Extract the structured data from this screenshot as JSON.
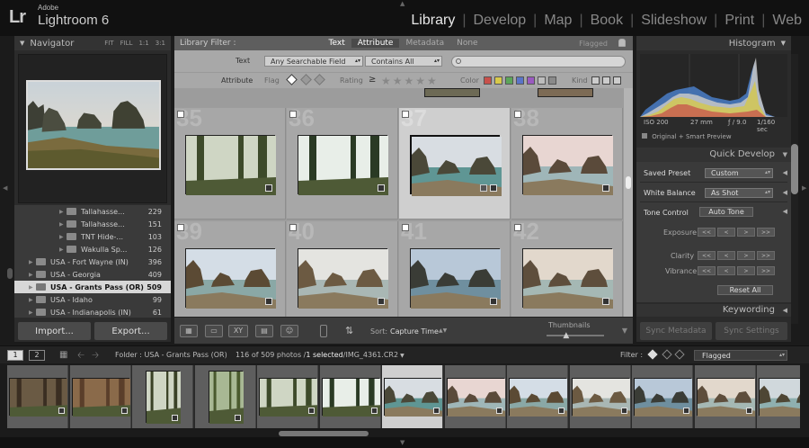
{
  "app": {
    "logo": "Lr",
    "vendor": "Adobe",
    "name": "Lightroom 6"
  },
  "modules": [
    {
      "label": "Library",
      "active": true
    },
    {
      "label": "Develop",
      "active": false
    },
    {
      "label": "Map",
      "active": false
    },
    {
      "label": "Book",
      "active": false
    },
    {
      "label": "Slideshow",
      "active": false
    },
    {
      "label": "Print",
      "active": false
    },
    {
      "label": "Web",
      "active": false
    }
  ],
  "navigator": {
    "title": "Navigator",
    "zooms": [
      "FIT",
      "FILL",
      "1:1",
      "3:1"
    ]
  },
  "folders": [
    {
      "name": "Tallahasse...",
      "count": "229",
      "level": 2,
      "selected": false
    },
    {
      "name": "Tallahasse...",
      "count": "151",
      "level": 2,
      "selected": false
    },
    {
      "name": "TNT Hide-...",
      "count": "103",
      "level": 2,
      "selected": false
    },
    {
      "name": "Wakulla Sp...",
      "count": "126",
      "level": 2,
      "selected": false
    },
    {
      "name": "USA - Fort Wayne (IN)",
      "count": "396",
      "level": 1,
      "selected": false
    },
    {
      "name": "USA - Georgia",
      "count": "409",
      "level": 1,
      "selected": false
    },
    {
      "name": "USA - Grants Pass (OR)",
      "count": "509",
      "level": 1,
      "selected": true
    },
    {
      "name": "USA - Idaho",
      "count": "99",
      "level": 1,
      "selected": false
    },
    {
      "name": "USA - Indianapolis (IN)",
      "count": "61",
      "level": 1,
      "selected": false
    }
  ],
  "left_buttons": {
    "import": "Import...",
    "export": "Export..."
  },
  "filter": {
    "title": "Library Filter :",
    "tabs": [
      "Text",
      "Attribute",
      "Metadata",
      "None"
    ],
    "preset": "Flagged",
    "text_label": "Text",
    "text_field": "Any Searchable Field",
    "text_rule": "Contains All",
    "search_placeholder": "",
    "attribute_label": "Attribute",
    "flag_label": "Flag",
    "rating_label": "Rating",
    "rating_op": "≥",
    "rating_stars": "★★★★★",
    "color_label": "Color",
    "kind_label": "Kind",
    "colors": [
      "#c8504a",
      "#d8c94a",
      "#5ca55a",
      "#5a74c8",
      "#9a5ac0",
      "#bdbdbd",
      "#8a8a8a"
    ]
  },
  "grid": {
    "cells": [
      {
        "num": "35",
        "selected": false
      },
      {
        "num": "36",
        "selected": false
      },
      {
        "num": "37",
        "selected": true
      },
      {
        "num": "38",
        "selected": false
      },
      {
        "num": "39",
        "selected": false
      },
      {
        "num": "40",
        "selected": false
      },
      {
        "num": "41",
        "selected": false
      },
      {
        "num": "42",
        "selected": false
      }
    ]
  },
  "toolbar": {
    "sort_label": "Sort:",
    "sort_value": "Capture Time",
    "thumbnails_label": "Thumbnails",
    "thumbnails_level": 0.35,
    "compare_xy": "XY"
  },
  "histogram": {
    "title": "Histogram",
    "iso": "ISO 200",
    "focal": "27 mm",
    "aperture": "ƒ / 9.0",
    "shutter": "1/160 sec",
    "preview_label": "Original + Smart Preview"
  },
  "quick_develop": {
    "title": "Quick Develop",
    "saved_preset_label": "Saved Preset",
    "saved_preset_value": "Custom",
    "white_balance_label": "White Balance",
    "white_balance_value": "As Shot",
    "tone_control_label": "Tone Control",
    "auto_tone": "Auto Tone",
    "exposure_label": "Exposure",
    "clarity_label": "Clarity",
    "vibrance_label": "Vibrance",
    "reset_all": "Reset All"
  },
  "keywording": {
    "title": "Keywording"
  },
  "right_buttons": {
    "sync_metadata": "Sync Metadata",
    "sync_settings": "Sync Settings"
  },
  "filmstrip_bar": {
    "monitor1": "1",
    "monitor2": "2",
    "folder": "Folder : USA - Grants Pass (OR)",
    "count_prefix": "116 of 509 photos /",
    "count_selected": "1 selected",
    "count_file": "/IMG_4361.CR2",
    "filter_label": "Filter :",
    "filter_value": "Flagged"
  }
}
